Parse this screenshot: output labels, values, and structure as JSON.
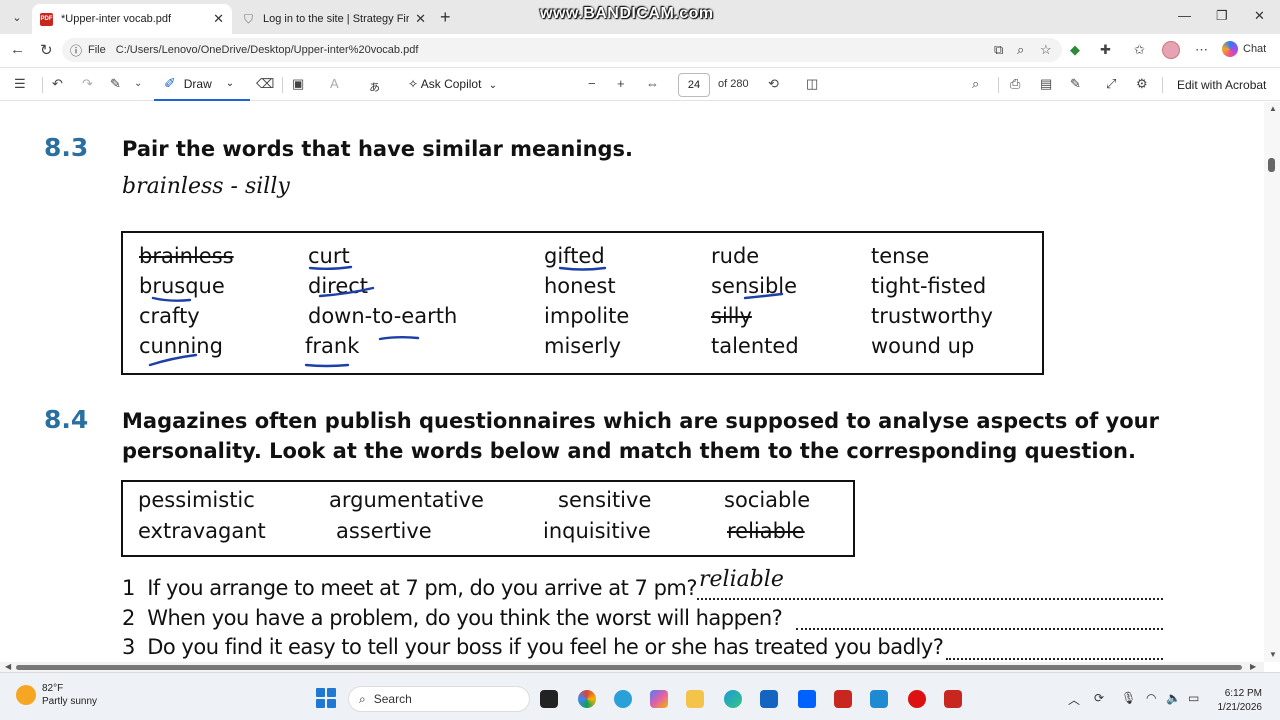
{
  "browser": {
    "tabs": [
      {
        "label": "*Upper-inter vocab.pdf",
        "active": true,
        "icon": "pdf-icon"
      },
      {
        "label": "Log in to the site | Strategy First In",
        "active": false,
        "icon": "shield-icon"
      }
    ],
    "watermark": "www.BANDICAM.com",
    "address": {
      "scheme_label": "File",
      "url": "C:/Users/Lenovo/OneDrive/Desktop/Upper-inter%20vocab.pdf"
    },
    "chat_label": "Chat"
  },
  "pdf_toolbar": {
    "draw_label": "Draw",
    "copilot_label": "Ask Copilot",
    "current_page": "24",
    "total_pages": "of 280",
    "acrobat_label": "Edit with Acrobat"
  },
  "document": {
    "section1": {
      "number": "8.3",
      "heading": "Pair the words that have similar meanings.",
      "example": "brainless - silly",
      "words": [
        {
          "text": "brainless",
          "struck": true
        },
        {
          "text": "brusque",
          "struck": false
        },
        {
          "text": "crafty",
          "struck": false
        },
        {
          "text": "cunning",
          "struck": false
        },
        {
          "text": "curt",
          "struck": false
        },
        {
          "text": "direct",
          "struck": false
        },
        {
          "text": "down-to-earth",
          "struck": false
        },
        {
          "text": "frank",
          "struck": false
        },
        {
          "text": "gifted",
          "struck": false
        },
        {
          "text": "honest",
          "struck": false
        },
        {
          "text": "impolite",
          "struck": false
        },
        {
          "text": "miserly",
          "struck": false
        },
        {
          "text": "rude",
          "struck": false
        },
        {
          "text": "sensible",
          "struck": false
        },
        {
          "text": "silly",
          "struck": true
        },
        {
          "text": "talented",
          "struck": false
        },
        {
          "text": "tense",
          "struck": false
        },
        {
          "text": "tight-fisted",
          "struck": false
        },
        {
          "text": "trustworthy",
          "struck": false
        },
        {
          "text": "wound up",
          "struck": false
        }
      ]
    },
    "section2": {
      "number": "8.4",
      "heading_line1": "Magazines often publish questionnaires which are supposed to analyse aspects of your",
      "heading_line2": "personality. Look at the words below and match them to the corresponding question.",
      "words": [
        {
          "text": "pessimistic",
          "struck": false
        },
        {
          "text": "extravagant",
          "struck": false
        },
        {
          "text": "argumentative",
          "struck": false
        },
        {
          "text": "assertive",
          "struck": false
        },
        {
          "text": "sensitive",
          "struck": false
        },
        {
          "text": "inquisitive",
          "struck": false
        },
        {
          "text": "sociable",
          "struck": false
        },
        {
          "text": "reliable",
          "struck": true
        }
      ],
      "questions": [
        {
          "num": "1",
          "text": "If you arrange to meet at 7 pm, do you arrive at 7 pm?",
          "answer": "reliable"
        },
        {
          "num": "2",
          "text": "When you have a problem, do you think the worst will happen?",
          "answer": ""
        },
        {
          "num": "3",
          "text": "Do you find it easy to tell your boss if you feel he or she has treated you badly?",
          "answer": ""
        }
      ]
    }
  },
  "taskbar": {
    "weather_temp": "82°F",
    "weather_desc": "Partly sunny",
    "search_label": "Search",
    "time": "6:12 PM",
    "date": "1/21/2026"
  },
  "colors": {
    "section_number": "#2b6fa1",
    "annotation_pen": "#1d3fa8",
    "draw_accent": "#1d64d6"
  }
}
